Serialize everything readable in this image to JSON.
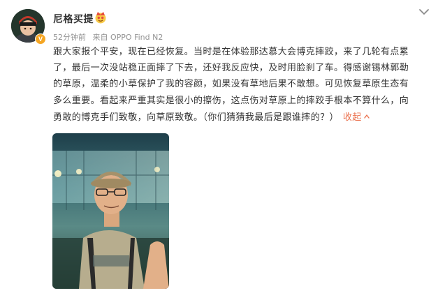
{
  "post": {
    "author": "尼格买提",
    "time_ago": "52分钟前",
    "source": "来自 OPPO Find N2",
    "text_lines": [
      "跟大家报个平安，现在已经恢复。当时是在体验那达慕大会博克摔跤，来了几轮有点累",
      "了，最后一次没站稳正面摔了下去，还好我反应快，及时用脸刹了车。得感谢锡林郭勒",
      "的草原，温柔的小草保护了我的容颜，如果没有草地后果不敢想。可见恢复草原生态有",
      "多么重要。看起来严重其实是很小的擦伤，这点伤对草原上的摔跤手根本不算什么，向",
      "勇敢的博克手们致敬，向草原致敬。（你们猜猜我最后是跟谁摔的？）"
    ],
    "collapse_label": "收起",
    "verified_mark": "V"
  },
  "icons": {
    "avatar": "avatar-photo",
    "verified": "verified-badge-icon",
    "member": "member-emoji-icon",
    "more": "chevron-down-icon",
    "collapse": "collapse-arrow-icon",
    "photo": "selfie-photo"
  },
  "colors": {
    "name": "#333333",
    "meta": "#939393",
    "link": "#eb7350",
    "verified": "#f5a623"
  }
}
